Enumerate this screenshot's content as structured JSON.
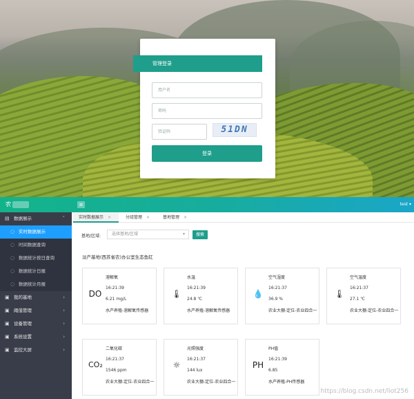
{
  "login": {
    "title": "管理登录",
    "username_placeholder": "用户名",
    "password_placeholder": "密码",
    "captcha_placeholder": "验证码",
    "captcha_text": "51DN",
    "submit_label": "登录"
  },
  "dashboard": {
    "logo_text": "农",
    "user_label": "test ▾",
    "sidebar": [
      {
        "label": "数据展示",
        "icon": "list-icon",
        "type": "group",
        "expanded": true
      },
      {
        "label": "实时数据展示",
        "icon": "bullet-icon",
        "type": "sub",
        "active": true
      },
      {
        "label": "时间数据查询",
        "icon": "bullet-icon",
        "type": "sub"
      },
      {
        "label": "数据统计按日查询",
        "icon": "bullet-icon",
        "type": "sub"
      },
      {
        "label": "数据统计日报",
        "icon": "bullet-icon",
        "type": "sub"
      },
      {
        "label": "数据统计月报",
        "icon": "bullet-icon",
        "type": "sub"
      },
      {
        "label": "我的基地",
        "icon": "group-icon",
        "type": "group"
      },
      {
        "label": "阈值管理",
        "icon": "group-icon",
        "type": "group"
      },
      {
        "label": "设备管理",
        "icon": "group-icon",
        "type": "group"
      },
      {
        "label": "系统设置",
        "icon": "group-icon",
        "type": "group"
      },
      {
        "label": "监控大屏",
        "icon": "group-icon",
        "type": "group"
      }
    ],
    "tabs": [
      {
        "label": "实时数据展示",
        "active": true
      },
      {
        "label": "分组管理",
        "active": false
      },
      {
        "label": "基地管理",
        "active": false
      }
    ],
    "filter": {
      "label": "基地/区域:",
      "placeholder": "选择基地/区域",
      "search_label": "搜索"
    },
    "section_title": "淡产基地(西苏省农)办公室生态鱼缸",
    "cards": [
      {
        "icon_text": "DO",
        "name": "溶解氧",
        "time": "16:21:39",
        "value": "6.21 mg/L",
        "location": "水产养殖-溶解氧传感器"
      },
      {
        "icon_text": "🌡",
        "name": "水温",
        "time": "16:21:39",
        "value": "24.8 ℃",
        "location": "水产养殖-溶解氧传感器"
      },
      {
        "icon_text": "💧",
        "name": "空气湿度",
        "time": "16:21:37",
        "value": "36.9 %",
        "location": "农业大棚-定位-农业四合一"
      },
      {
        "icon_text": "🌡",
        "name": "空气温度",
        "time": "16:21:37",
        "value": "27.1 ℃",
        "location": "农业大棚-定位-农业四合一"
      },
      {
        "icon_text": "CO₂",
        "name": "二氧化碳",
        "time": "16:21:37",
        "value": "1546 ppm",
        "location": "农业大棚-定位-农业四合一"
      },
      {
        "icon_text": "☼",
        "name": "光照强度",
        "time": "16:21:37",
        "value": "144 lux",
        "location": "农业大棚-定位-农业四合一"
      },
      {
        "icon_text": "PH",
        "name": "PH值",
        "time": "16:21:39",
        "value": "6.85",
        "location": "水产养殖-PH传感器"
      }
    ],
    "watermark": "https://blog.csdn.net/liot256"
  },
  "colors": {
    "accent": "#1e9e8b",
    "sidebar_bg": "#393d49",
    "sidebar_active": "#1e9fff"
  }
}
